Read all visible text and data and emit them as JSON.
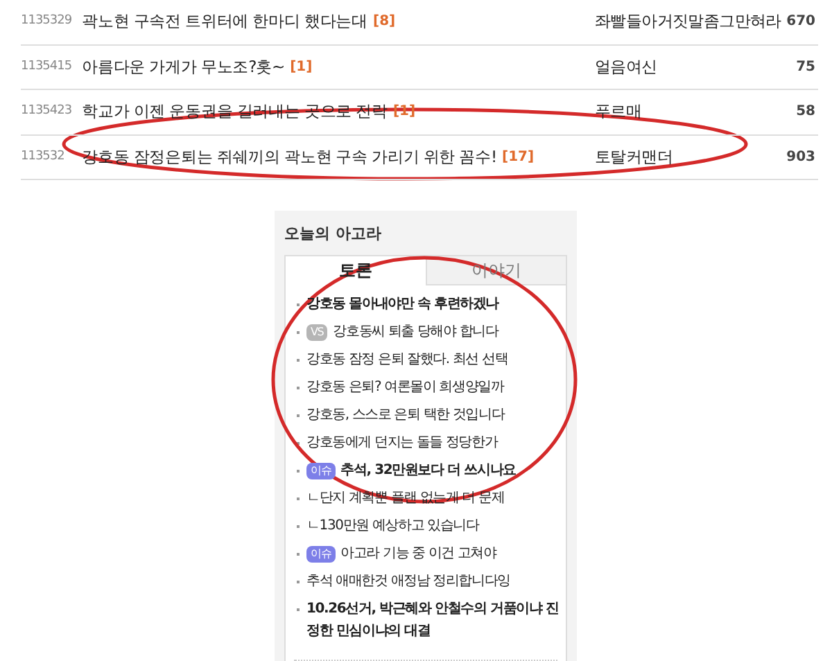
{
  "posts": [
    {
      "id": "1135329",
      "title": "곽노현 구속전 트위터에 한마디 했다는대",
      "comments": "[8]",
      "author": "좌빨들아거짓말좀그만혀라",
      "views": "670"
    },
    {
      "id": "1135415",
      "title": "아름다운 가게가 무노조?홋~",
      "comments": "[1]",
      "author": "얼음여신",
      "views": "75"
    },
    {
      "id": "1135423",
      "title": "학교가 이젠 운동권을 길러내는 곳으로 전락",
      "comments": "[1]",
      "author": "푸르매",
      "views": "58"
    },
    {
      "id": "113532",
      "title": "강호동 잠정은퇴는 쥐쉐끼의 곽노현 구속 가리기 위한 꼼수!",
      "comments": "[17]",
      "author": "토탈커맨더",
      "views": "903"
    }
  ],
  "agora": {
    "title": "오늘의 아고라",
    "tabs": [
      {
        "label": "토론",
        "selected": true
      },
      {
        "label": "이야기",
        "selected": false
      }
    ],
    "items": [
      {
        "kind": "plain",
        "text": "강호동 몰아내야만 속 후련하겠나",
        "bold": true
      },
      {
        "kind": "vs",
        "badge": "VS",
        "text": "강호동씨 퇴출 당해야 합니다",
        "bold": false
      },
      {
        "kind": "plain",
        "text": "강호동 잠정 은퇴 잘했다. 최선 선택",
        "bold": false
      },
      {
        "kind": "plain",
        "text": "강호동 은퇴? 여론몰이 희생양일까",
        "bold": false
      },
      {
        "kind": "plain",
        "text": "강호동, 스스로 은퇴 택한 것입니다",
        "bold": false
      },
      {
        "kind": "plain",
        "text": "강호동에게 던지는 돌들 정당한가",
        "bold": false
      },
      {
        "kind": "issue",
        "badge": "이슈",
        "text": "추석, 32만원보다 더 쓰시나요",
        "bold": true
      },
      {
        "kind": "plain",
        "text": "ㄴ단지 계획뿐 플랜 없는게 더 문제",
        "bold": false
      },
      {
        "kind": "plain",
        "text": "ㄴ130만원 예상하고 있습니다",
        "bold": false
      },
      {
        "kind": "issue",
        "badge": "이슈",
        "text": "아고라 기능 중 이건 고쳐야",
        "bold": false
      },
      {
        "kind": "plain",
        "text": "추석 애매한것 애정남 정리합니다잉",
        "bold": false
      },
      {
        "kind": "plain",
        "text": "10.26선거, 박근혜와 안철수의 거품이냐 진정한 민심이냐의 대결",
        "bold": true
      }
    ]
  }
}
